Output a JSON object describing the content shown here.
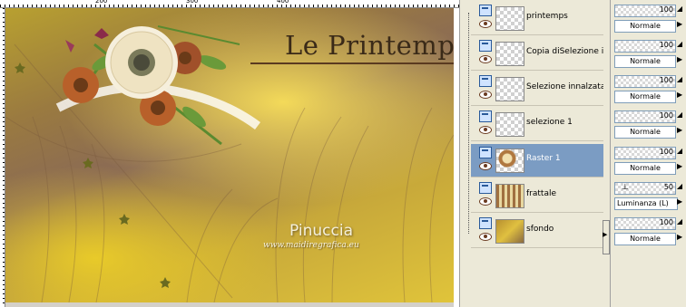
{
  "canvas": {
    "ruler_labels": [
      "200",
      "300",
      "400"
    ],
    "title": "Le Printemps",
    "watermark_name": "Pinuccia",
    "watermark_url": "www.maidiregrafica.eu"
  },
  "layers": [
    {
      "name": "printemps",
      "thumb": "checker",
      "selected": false
    },
    {
      "name": "Copia diSelezione in",
      "thumb": "checker",
      "selected": false
    },
    {
      "name": "Selezione innalzata",
      "thumb": "checker",
      "selected": false
    },
    {
      "name": "selezione 1",
      "thumb": "checker",
      "selected": false
    },
    {
      "name": "Raster 1",
      "thumb": "flower",
      "selected": true
    },
    {
      "name": "frattale",
      "thumb": "frattale",
      "selected": false
    },
    {
      "name": "sfondo",
      "thumb": "sfondo",
      "selected": false
    }
  ],
  "properties": [
    {
      "opacity": "100",
      "blend": "Normale"
    },
    {
      "opacity": "100",
      "blend": "Normale"
    },
    {
      "opacity": "100",
      "blend": "Normale"
    },
    {
      "opacity": "100",
      "blend": "Normale"
    },
    {
      "opacity": "100",
      "blend": "Normale"
    },
    {
      "opacity": "50",
      "blend": "Luminanza (L)"
    },
    {
      "opacity": "100",
      "blend": "Normale"
    }
  ],
  "colors": {
    "selected_row": "#7b9cc3",
    "panel_bg": "#ece9d8",
    "title_color": "#3a2a18"
  }
}
